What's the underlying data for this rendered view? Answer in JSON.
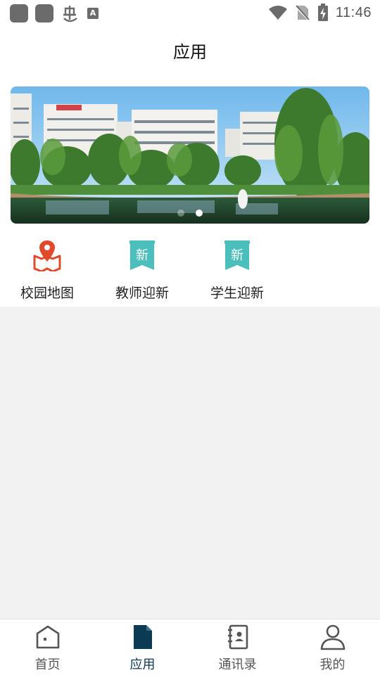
{
  "status_bar": {
    "time": "11:46",
    "left_icons": [
      "app-square-icon",
      "app-square-icon",
      "bug-icon",
      "text-a-icon"
    ],
    "right_icons": [
      "wifi-icon",
      "no-sim-icon",
      "battery-charging-icon"
    ]
  },
  "header": {
    "title": "应用"
  },
  "banner": {
    "image": "campus-photo",
    "page_count": 2,
    "active_index": 1
  },
  "apps": [
    {
      "label": "校园地图",
      "icon": "map-pin-icon",
      "color": "#e0492a"
    },
    {
      "label": "教师迎新",
      "icon": "new-badge-icon",
      "badge": "新",
      "color": "#4cbfbd"
    },
    {
      "label": "学生迎新",
      "icon": "new-badge-icon",
      "badge": "新",
      "color": "#4cbfbd"
    }
  ],
  "bottom_nav": [
    {
      "label": "首页",
      "icon": "home-icon",
      "active": false
    },
    {
      "label": "应用",
      "icon": "document-icon",
      "active": true
    },
    {
      "label": "通讯录",
      "icon": "contacts-book-icon",
      "active": false
    },
    {
      "label": "我的",
      "icon": "person-icon",
      "active": false
    }
  ],
  "colors": {
    "accent": "#0b3a55",
    "inactive": "#555555",
    "map_red": "#e0492a",
    "teal": "#4cbfbd",
    "background": "#f2f2f2"
  }
}
